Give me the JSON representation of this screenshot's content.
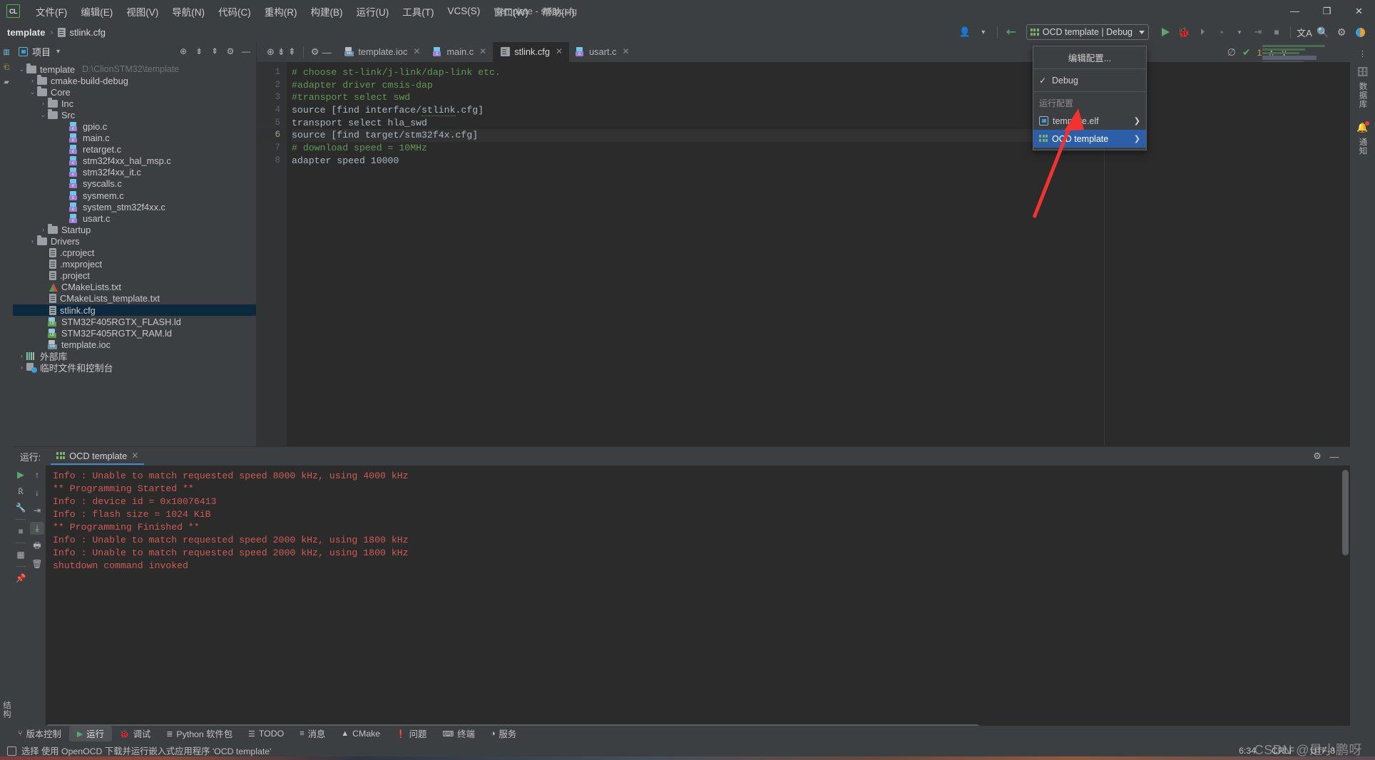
{
  "window": {
    "title": "template - stlink.cfg",
    "logo": "CL",
    "minimize": "—",
    "maximize": "❐",
    "close": "✕"
  },
  "menubar": {
    "items": [
      {
        "label": "文件(F)",
        "name": "menu-file"
      },
      {
        "label": "编辑(E)",
        "name": "menu-edit"
      },
      {
        "label": "视图(V)",
        "name": "menu-view"
      },
      {
        "label": "导航(N)",
        "name": "menu-navigate"
      },
      {
        "label": "代码(C)",
        "name": "menu-code"
      },
      {
        "label": "重构(R)",
        "name": "menu-refactor"
      },
      {
        "label": "构建(B)",
        "name": "menu-build"
      },
      {
        "label": "运行(U)",
        "name": "menu-run"
      },
      {
        "label": "工具(T)",
        "name": "menu-tools"
      },
      {
        "label": "VCS(S)",
        "name": "menu-vcs"
      },
      {
        "label": "窗口(W)",
        "name": "menu-window"
      },
      {
        "label": "帮助(H)",
        "name": "menu-help"
      }
    ]
  },
  "breadcrumb": {
    "project": "template",
    "separator": "›",
    "file": "stlink.cfg"
  },
  "toolbar": {
    "run_config_label": "OCD template | Debug",
    "icons": {
      "user": "👤",
      "hammer": "↗",
      "run": "▶",
      "debug": "🐞",
      "run_with_cov": "↺",
      "profile": "◔",
      "attach": "⬇",
      "stop": "■",
      "translate": "文A",
      "search": "🔍",
      "settings": "⚙",
      "theme": "◐"
    }
  },
  "run_config_menu": {
    "edit_configurations": "编辑配置...",
    "check_mark": "✓",
    "debug_item": "Debug",
    "section_header": "运行配置",
    "items": [
      {
        "label": "template.elf",
        "arrow": "❯",
        "selected": false
      },
      {
        "label": "OCD template",
        "arrow": "❯",
        "selected": true
      }
    ],
    "highlight_color": "#2d5fa8"
  },
  "left_strip": {
    "project_label": "项目",
    "commit_label": "提交",
    "structure_label": "结构"
  },
  "project_panel": {
    "title": "项目",
    "dropdown_caret": "▾",
    "actions": [
      "target-icon",
      "collapse-all-icon",
      "expand-icon",
      "gear-icon",
      "hide-icon"
    ],
    "tree": [
      {
        "label": "template",
        "path": "D:\\ClionSTM32\\template",
        "icon": "folder",
        "indent": 0,
        "twist": "⌄",
        "selected": false
      },
      {
        "label": "cmake-build-debug",
        "path": "",
        "icon": "folder",
        "indent": 1,
        "twist": "›",
        "selected": false
      },
      {
        "label": "Core",
        "path": "",
        "icon": "folder",
        "indent": 1,
        "twist": "⌄",
        "selected": false
      },
      {
        "label": "Inc",
        "path": "",
        "icon": "folder",
        "indent": 2,
        "twist": "›",
        "selected": false
      },
      {
        "label": "Src",
        "path": "",
        "icon": "folder",
        "indent": 2,
        "twist": "⌄",
        "selected": false
      },
      {
        "label": "gpio.c",
        "path": "",
        "icon": "c",
        "indent": 4,
        "twist": "",
        "selected": false
      },
      {
        "label": "main.c",
        "path": "",
        "icon": "c",
        "indent": 4,
        "twist": "",
        "selected": false
      },
      {
        "label": "retarget.c",
        "path": "",
        "icon": "c",
        "indent": 4,
        "twist": "",
        "selected": false
      },
      {
        "label": "stm32f4xx_hal_msp.c",
        "path": "",
        "icon": "c",
        "indent": 4,
        "twist": "",
        "selected": false
      },
      {
        "label": "stm32f4xx_it.c",
        "path": "",
        "icon": "c",
        "indent": 4,
        "twist": "",
        "selected": false
      },
      {
        "label": "syscalls.c",
        "path": "",
        "icon": "c",
        "indent": 4,
        "twist": "",
        "selected": false
      },
      {
        "label": "sysmem.c",
        "path": "",
        "icon": "c",
        "indent": 4,
        "twist": "",
        "selected": false
      },
      {
        "label": "system_stm32f4xx.c",
        "path": "",
        "icon": "c",
        "indent": 4,
        "twist": "",
        "selected": false
      },
      {
        "label": "usart.c",
        "path": "",
        "icon": "c",
        "indent": 4,
        "twist": "",
        "selected": false
      },
      {
        "label": "Startup",
        "path": "",
        "icon": "folder",
        "indent": 2,
        "twist": "›",
        "selected": false
      },
      {
        "label": "Drivers",
        "path": "",
        "icon": "folder",
        "indent": 1,
        "twist": "›",
        "selected": false
      },
      {
        "label": ".cproject",
        "path": "",
        "icon": "file",
        "indent": 2,
        "twist": "",
        "selected": false
      },
      {
        "label": ".mxproject",
        "path": "",
        "icon": "file",
        "indent": 2,
        "twist": "",
        "selected": false
      },
      {
        "label": ".project",
        "path": "",
        "icon": "file",
        "indent": 2,
        "twist": "",
        "selected": false
      },
      {
        "label": "CMakeLists.txt",
        "path": "",
        "icon": "cmake",
        "indent": 2,
        "twist": "",
        "selected": false
      },
      {
        "label": "CMakeLists_template.txt",
        "path": "",
        "icon": "file",
        "indent": 2,
        "twist": "",
        "selected": false
      },
      {
        "label": "stlink.cfg",
        "path": "",
        "icon": "file",
        "indent": 2,
        "twist": "",
        "selected": true
      },
      {
        "label": "STM32F405RGTX_FLASH.ld",
        "path": "",
        "icon": "ld",
        "indent": 2,
        "twist": "",
        "selected": false
      },
      {
        "label": "STM32F405RGTX_RAM.ld",
        "path": "",
        "icon": "ld",
        "indent": 2,
        "twist": "",
        "selected": false
      },
      {
        "label": "template.ioc",
        "path": "",
        "icon": "ioc",
        "indent": 2,
        "twist": "",
        "selected": false
      },
      {
        "label": "外部库",
        "path": "",
        "icon": "lib",
        "indent": 0,
        "twist": "›",
        "selected": false
      },
      {
        "label": "临时文件和控制台",
        "path": "",
        "icon": "scratch",
        "indent": 0,
        "twist": "›",
        "selected": false
      }
    ]
  },
  "editor": {
    "tabs": [
      {
        "label": "template.ioc",
        "icon": "ioc",
        "active": false
      },
      {
        "label": "main.c",
        "icon": "c",
        "active": false
      },
      {
        "label": "stlink.cfg",
        "icon": "file",
        "active": true
      },
      {
        "label": "usart.c",
        "icon": "c",
        "active": false
      }
    ],
    "close_glyph": "✕",
    "inspection": {
      "eye_off": "⊘",
      "check": "✔",
      "count": "1",
      "up": "∧",
      "down": "∨"
    },
    "lines": [
      {
        "n": "1",
        "text": "# choose st-link/j-link/dap-link etc.",
        "type": "comment",
        "current": false
      },
      {
        "n": "2",
        "text": "#adapter driver cmsis-dap",
        "type": "comment",
        "current": false
      },
      {
        "n": "3",
        "text": "#transport select swd",
        "type": "comment",
        "current": false
      },
      {
        "n": "4",
        "text": "source [find interface/stlink.cfg]",
        "type": "code",
        "current": false
      },
      {
        "n": "5",
        "text": "transport select hla_swd",
        "type": "code",
        "current": false
      },
      {
        "n": "6",
        "text": "source [find target/stm32f4x.cfg]",
        "type": "code",
        "current": true
      },
      {
        "n": "7",
        "text": "# download speed = 10MHz",
        "type": "comment",
        "current": false
      },
      {
        "n": "8",
        "text": "adapter speed 10000",
        "type": "code",
        "current": false
      }
    ]
  },
  "right_strip": {
    "database_label": "数据库",
    "notifications_label": "通知",
    "more_glyph": "⋮",
    "db_icon": "🗄",
    "bell_icon": "🔔"
  },
  "run_panel": {
    "label": "运行:",
    "tab_label": "OCD template",
    "close_glyph": "✕",
    "settings_glyph": "⚙",
    "minimize_glyph": "—",
    "console_lines": [
      "Info : Unable to match requested speed 8000 kHz, using 4000 kHz",
      "** Programming Started **",
      "Info : device id = 0x10076413",
      "Info : flash size = 1024 KiB",
      "** Programming Finished **",
      "Info : Unable to match requested speed 2000 kHz, using 1800 kHz",
      "Info : Unable to match requested speed 2000 kHz, using 1800 kHz",
      "shutdown command invoked"
    ],
    "console_text_color": "#cf5b56",
    "toolbar_left": [
      "run-icon",
      "rerun-icon",
      "wrench-icon",
      "stop-icon",
      "layout-icon",
      "pin-icon"
    ],
    "toolbar_right": [
      "scroll-up-icon",
      "scroll-down-icon",
      "soft-wrap-icon",
      "scroll-to-end-icon",
      "print-icon",
      "trash-icon"
    ]
  },
  "tool_window_bar": {
    "items": [
      {
        "label": "版本控制",
        "icon": "⑂",
        "active": false
      },
      {
        "label": "运行",
        "icon": "▶",
        "active": true
      },
      {
        "label": "调试",
        "icon": "🐞",
        "active": false
      },
      {
        "label": "Python 软件包",
        "icon": "≣",
        "active": false
      },
      {
        "label": "TODO",
        "icon": "☰",
        "active": false
      },
      {
        "label": "消息",
        "icon": "≡",
        "active": false
      },
      {
        "label": "CMake",
        "icon": "▲",
        "active": false
      },
      {
        "label": "问题",
        "icon": "❗",
        "active": false
      },
      {
        "label": "终端",
        "icon": "⌨",
        "active": false
      },
      {
        "label": "服务",
        "icon": "◑",
        "active": false
      }
    ]
  },
  "status_bar": {
    "message": "选择 使用 OpenOCD 下载并运行嵌入式应用程序 'OCD template'",
    "caret_position": "6:34",
    "line_separator": "CRLF",
    "encoding": "UTF-8"
  },
  "watermark": {
    "text": "CSDN @是小鹏呀"
  }
}
